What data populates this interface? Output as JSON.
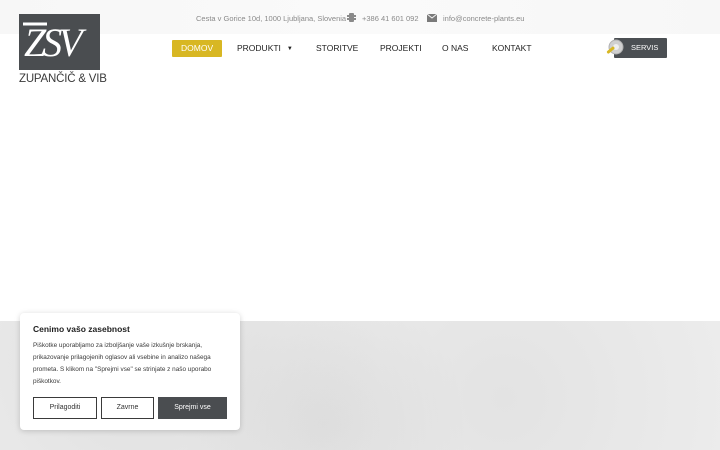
{
  "header": {
    "logo": {
      "mark": "ZSV",
      "name": "ZUPANČIČ & VIB"
    },
    "address": "Cesta v Gorice 10d, 1000 Ljubljana, Slovenia",
    "phone": "+386 41 601 092",
    "email": "info@concrete-plants.eu"
  },
  "nav": {
    "items": [
      {
        "label": "DOMOV",
        "active": true
      },
      {
        "label": "PRODUKTI",
        "has_dropdown": true
      },
      {
        "label": "STORITVE"
      },
      {
        "label": "PROJEKTI"
      },
      {
        "label": "O NAS"
      },
      {
        "label": "KONTAKT"
      }
    ],
    "servis_label": "SERVIS"
  },
  "cookie_banner": {
    "title": "Cenimo vašo zasebnost",
    "text": "Piškotke uporabljamo za izboljšanje vaše izkušnje brskanja, prikazovanje prilagojenih oglasov ali vsebine in analizo našega prometa. S klikom na \"Sprejmi vse\" se strinjate z našo uporabo piškotkov.",
    "buttons": {
      "customize": "Prilagoditi",
      "reject": "Zavrne",
      "accept": "Sprejmi vse"
    }
  },
  "colors": {
    "accent": "#d8b723",
    "dark": "#4a4d50"
  }
}
